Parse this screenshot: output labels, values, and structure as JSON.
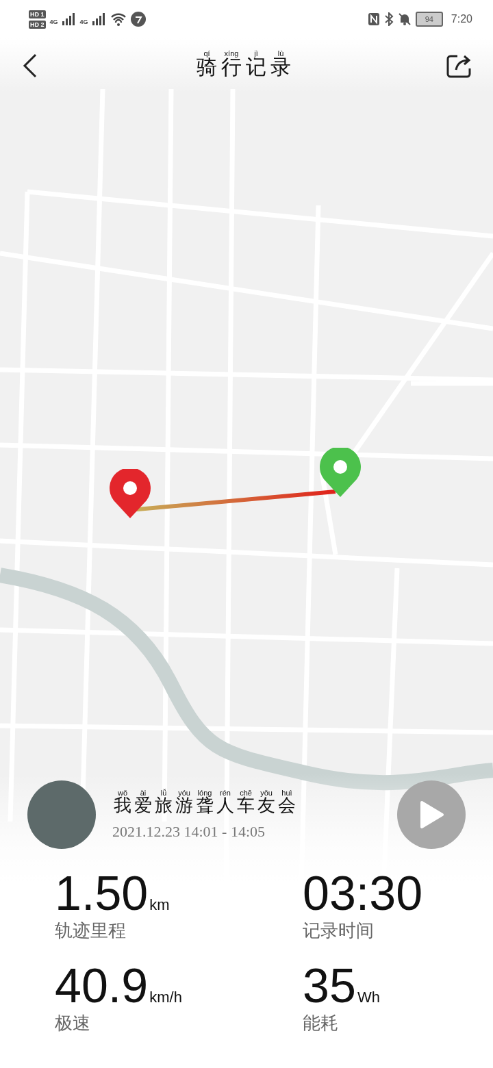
{
  "status_bar": {
    "sims": [
      "HD 1",
      "HD 2"
    ],
    "networks": [
      "4G",
      "4G"
    ],
    "battery": "94",
    "time": "7:20"
  },
  "header": {
    "title": [
      {
        "char": "骑",
        "pinyin": "qí"
      },
      {
        "char": "行",
        "pinyin": "xíng"
      },
      {
        "char": "记",
        "pinyin": "jì"
      },
      {
        "char": "录",
        "pinyin": "lù"
      }
    ]
  },
  "ride": {
    "club": [
      {
        "char": "我",
        "pinyin": "wǒ"
      },
      {
        "char": "爱",
        "pinyin": "ài"
      },
      {
        "char": "旅",
        "pinyin": "lǚ"
      },
      {
        "char": "游",
        "pinyin": "yóu"
      },
      {
        "char": "聋",
        "pinyin": "lóng"
      },
      {
        "char": "人",
        "pinyin": "rén"
      },
      {
        "char": "车",
        "pinyin": "chē"
      },
      {
        "char": "友",
        "pinyin": "yǒu"
      },
      {
        "char": "会",
        "pinyin": "huì"
      }
    ],
    "time_range": "2021.12.23 14:01 - 14:05"
  },
  "stats": [
    {
      "value": "1.50",
      "unit": "km",
      "label": "轨迹里程"
    },
    {
      "value": "03:30",
      "label": "记录时间"
    },
    {
      "value": "40.9",
      "unit": "km/h",
      "label": "极速"
    },
    {
      "value": "35",
      "unit": "Wh",
      "label": "能耗"
    }
  ]
}
